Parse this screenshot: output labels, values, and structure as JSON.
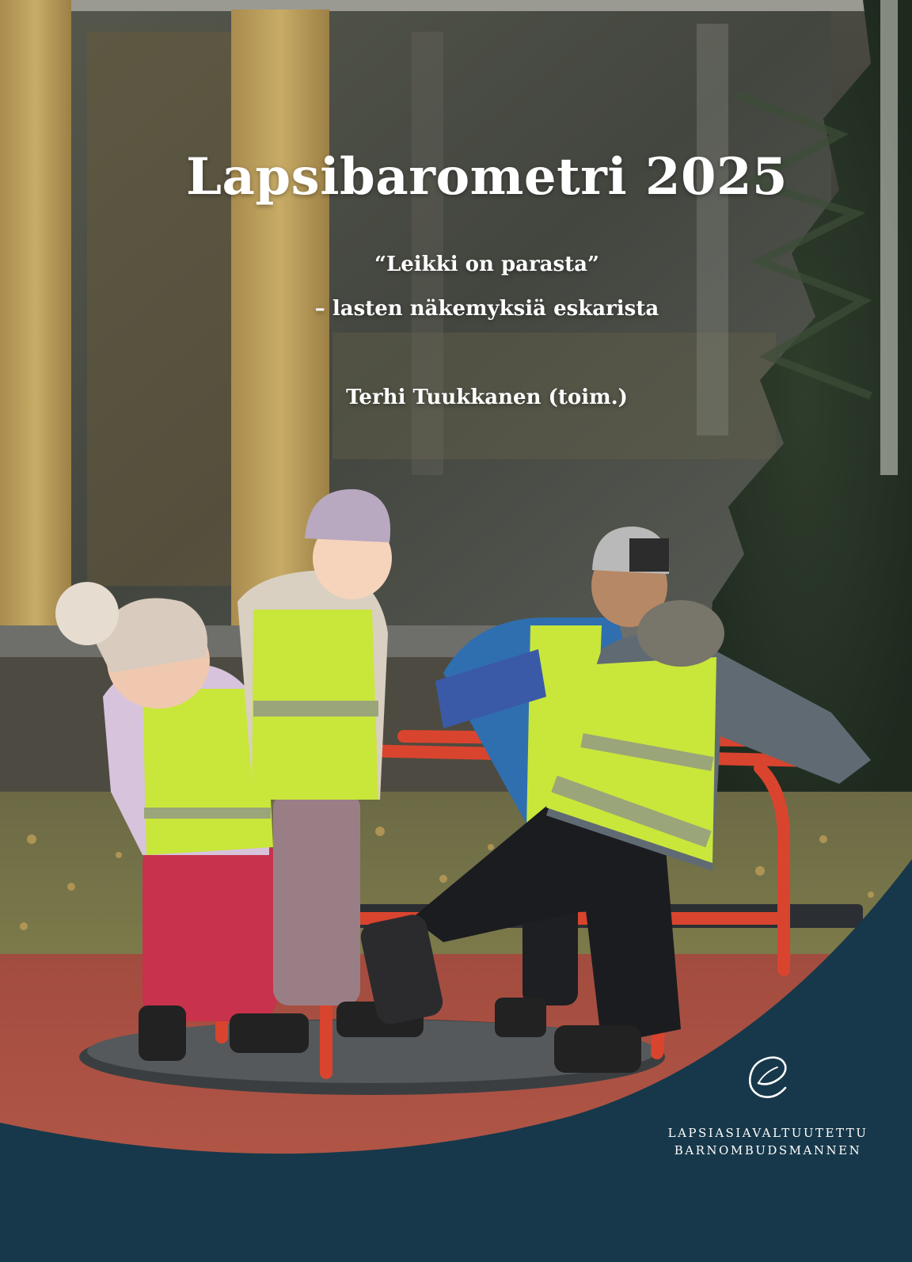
{
  "cover": {
    "title": "Lapsibarometri 2025",
    "subtitle_line1": "“Leikki on parasta”",
    "subtitle_line2": "– lasten näkemyksiä eskarista",
    "editor": "Terhi Tuukkanen (toim.)"
  },
  "publisher": {
    "logo_icon": "leaf-e-logo-icon",
    "name_fi": "LAPSIASIAVALTUUTETTU",
    "name_sv": "BARNOMBUDSMANNEN"
  },
  "colors": {
    "band": "#17384a",
    "text": "#ffffff",
    "carousel": "#d9442e",
    "vest": "#c9e63b"
  }
}
